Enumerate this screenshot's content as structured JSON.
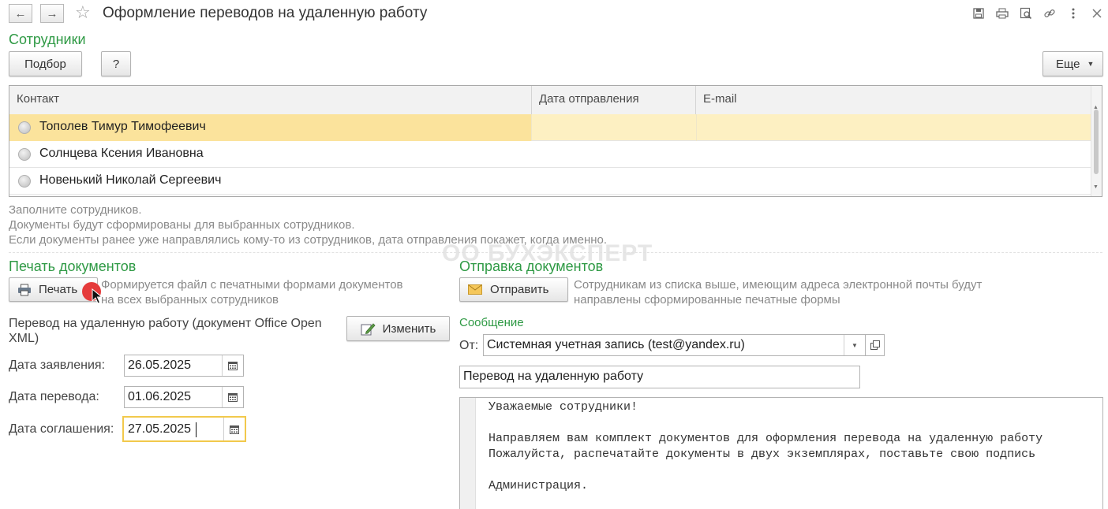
{
  "window": {
    "title": "Оформление переводов на удаленную работу",
    "back_icon": "←",
    "forward_icon": "→",
    "favorite_icon": "☆",
    "toolbar_icons": [
      "save-icon",
      "print-icon",
      "preview-icon",
      "link-icon",
      "more-icon",
      "close-icon"
    ]
  },
  "employees": {
    "section_title": "Сотрудники",
    "select_button": "Подбор",
    "help_button": "?",
    "more_button": "Еще",
    "columns": [
      "Контакт",
      "Дата отправления",
      "E-mail"
    ],
    "rows": [
      {
        "contact": "Тополев Тимур Тимофеевич",
        "date": "",
        "email": "",
        "selected": true
      },
      {
        "contact": "Солнцева Ксения Ивановна",
        "date": "",
        "email": "",
        "selected": false
      },
      {
        "contact": "Новенький Николай Сергеевич",
        "date": "",
        "email": "",
        "selected": false
      }
    ],
    "hints": [
      "Заполните сотрудников.",
      "Документы будут сформированы для выбранных сотрудников.",
      "Если документы ранее уже направлялись кому-то из сотрудников, дата отправления покажет, когда именно."
    ]
  },
  "watermark": "ОО БУХЭКСПЕРТ",
  "print": {
    "section_title": "Печать документов",
    "print_button": "Печать",
    "print_desc_1": "Формируется файл с печатными формами документов",
    "print_desc_2": "на всех выбранных сотрудников",
    "doc_title_1": "Перевод на удаленную работу (документ Office Open",
    "doc_title_2": "XML)",
    "edit_button": "Изменить",
    "fields": [
      {
        "label": "Дата заявления:",
        "value": "26.05.2025"
      },
      {
        "label": "Дата перевода:",
        "value": "01.06.2025"
      },
      {
        "label": "Дата соглашения:",
        "value": "27.05.2025"
      }
    ]
  },
  "send": {
    "section_title": "Отправка документов",
    "send_button": "Отправить",
    "send_desc_1": "Сотрудникам из списка выше, имеющим адреса электронной почты будут",
    "send_desc_2": "направлены сформированные печатные формы",
    "message_title": "Сообщение",
    "from_label": "От:",
    "from_value": "Системная учетная запись (test@yandex.ru)",
    "subject": "Перевод на удаленную работу",
    "body_lines": [
      "Уважаемые сотрудники!",
      "",
      "Направляем вам комплект документов для оформления перевода на удаленную работу",
      "Пожалуйста, распечатайте документы в двух экземплярах, поставьте свою подпись",
      "",
      "Администрация."
    ]
  },
  "colors": {
    "section_green": "#2f9a45",
    "selected_row": "#fdf0c2",
    "selected_cell": "#fbe39c",
    "focus_border": "#f2c94c",
    "hint_gray": "#8a8a8a"
  }
}
